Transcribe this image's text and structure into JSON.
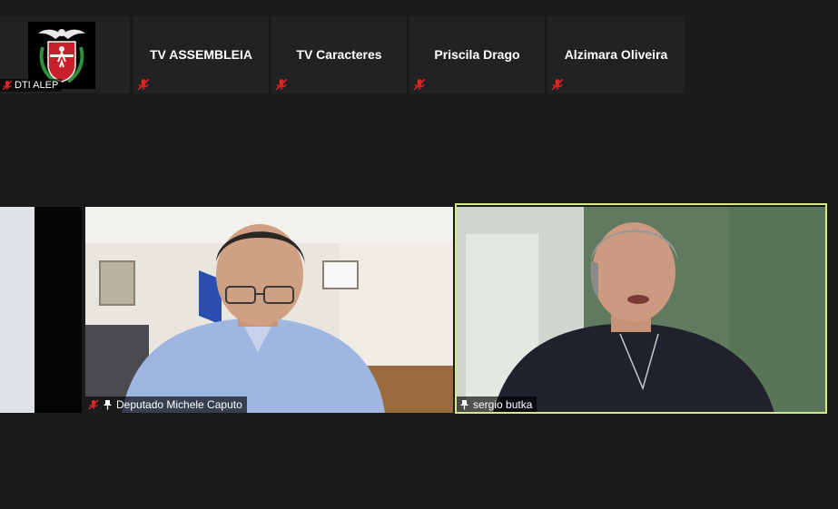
{
  "participants_strip": [
    {
      "name": "DTI ALEP"
    },
    {
      "name": "TV ASSEMBLEIA"
    },
    {
      "name": "TV Caracteres"
    },
    {
      "name": "Priscila Drago"
    },
    {
      "name": "Alzimara Oliveira"
    }
  ],
  "videos": [
    {
      "name": ""
    },
    {
      "name": "Deputado Michele Caputo"
    },
    {
      "name": "sergio butka"
    }
  ],
  "colors": {
    "background": "#1a1a1a",
    "tile": "#222222",
    "mute": "#e02424",
    "active_speaker": "#d6e88a"
  }
}
